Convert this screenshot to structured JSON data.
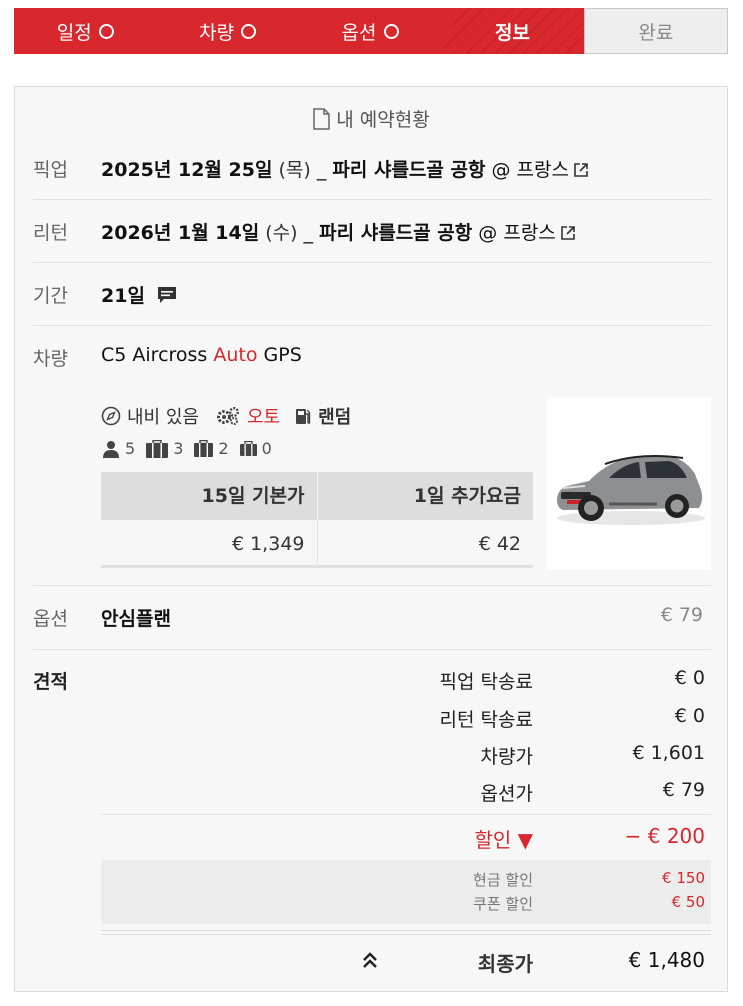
{
  "steps": [
    {
      "label": "일정",
      "state": "done-check"
    },
    {
      "label": "차량",
      "state": "done-check"
    },
    {
      "label": "옵션",
      "state": "done-check"
    },
    {
      "label": "정보",
      "state": "active"
    },
    {
      "label": "완료",
      "state": "pending"
    }
  ],
  "card": {
    "title": "내 예약현황",
    "title_icon": "document-icon"
  },
  "pickup": {
    "label": "픽업",
    "date": "2025년 12월 25일",
    "weekday": "(목)",
    "separator": "_",
    "place": "파리 샤를드골 공항",
    "country": "@ 프랑스",
    "link_icon": "external-link-icon"
  },
  "return": {
    "label": "리턴",
    "date": "2026년 1월 14일",
    "weekday": "(수)",
    "separator": "_",
    "place": "파리 샤를드골 공항",
    "country": "@ 프랑스",
    "link_icon": "external-link-icon"
  },
  "period": {
    "label": "기간",
    "value": "21일",
    "icon": "comment-icon"
  },
  "vehicle": {
    "label": "차량",
    "model": "C5 Aircross",
    "transmission": "Auto",
    "extra": "GPS",
    "features": {
      "nav": "내비 있음",
      "gear": "오토",
      "fuel": "랜덤"
    },
    "capacity": {
      "passengers": "5",
      "large_bags": "3",
      "medium_bags": "2",
      "small_bags": "0"
    },
    "price_table": {
      "headers": [
        "15일 기본가",
        "1일 추가요금"
      ],
      "values": [
        "€ 1,349",
        "€ 42"
      ]
    }
  },
  "option": {
    "label": "옵션",
    "name": "안심플랜",
    "price": "€ 79"
  },
  "estimate": {
    "label": "견적",
    "lines": [
      {
        "k": "픽업 탁송료",
        "v": "€ 0"
      },
      {
        "k": "리턴 탁송료",
        "v": "€ 0"
      },
      {
        "k": "차량가",
        "v": "€ 1,601"
      },
      {
        "k": "옵션가",
        "v": "€ 79"
      }
    ],
    "discount": {
      "k": "할인 ▼",
      "v": "− € 200"
    },
    "sub_discounts": [
      {
        "k": "현금 할인",
        "v": "€ 150"
      },
      {
        "k": "쿠폰 할인",
        "v": "€ 50"
      }
    ],
    "total": {
      "k": "최종가",
      "v": "€ 1,480"
    }
  },
  "colors": {
    "brand_red": "#d9272e",
    "card_bg": "#f7f7f7",
    "table_header": "#dddddd"
  }
}
